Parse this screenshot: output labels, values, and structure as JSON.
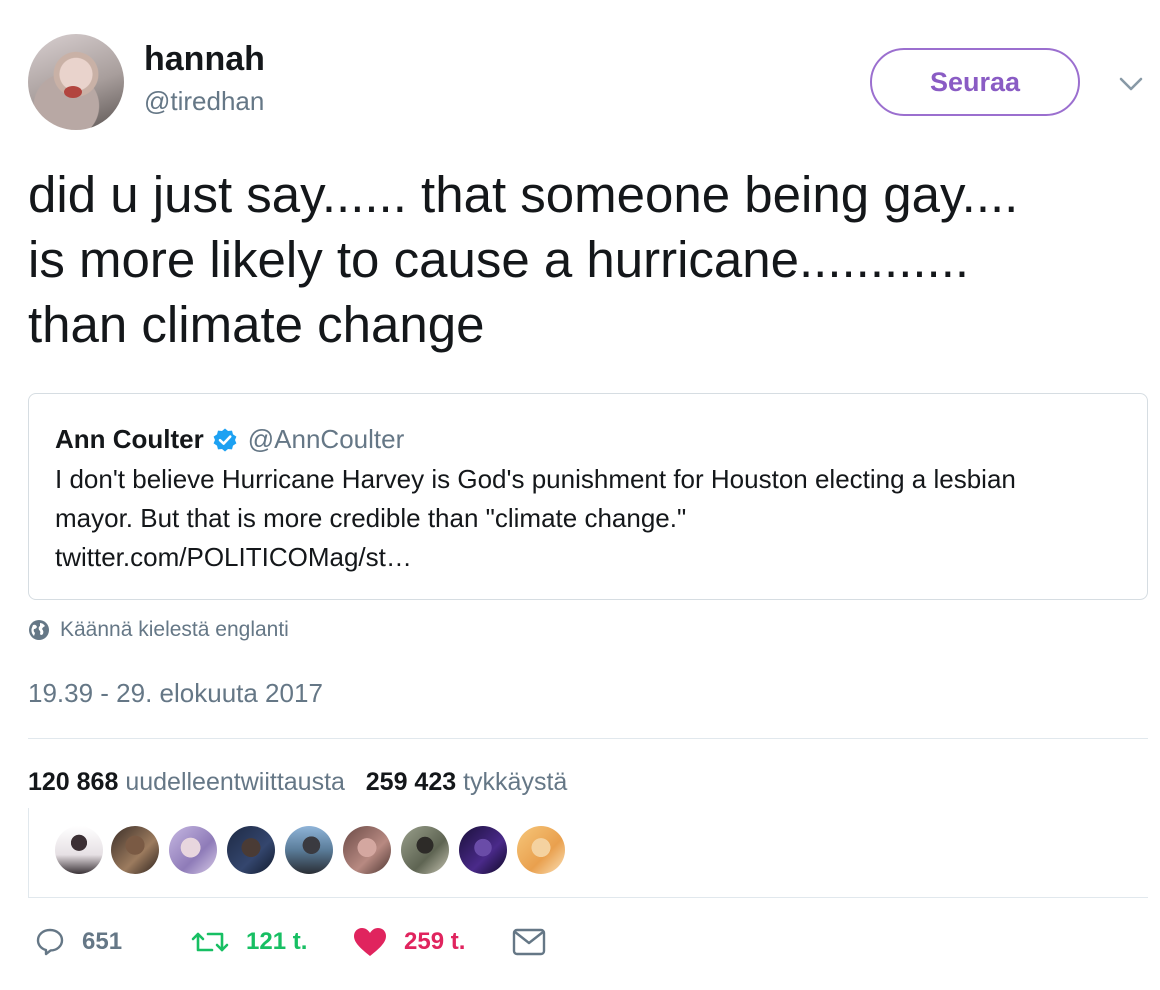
{
  "author": {
    "display_name": "hannah",
    "handle": "@tiredhan",
    "follow_label": "Seuraa"
  },
  "tweet": {
    "lines": [
      "did u just say...... that someone being gay....",
      "is more likely to cause a hurricane............",
      "than climate change"
    ]
  },
  "quoted_tweet": {
    "display_name": "Ann Coulter",
    "handle": "@AnnCoulter",
    "lines": [
      "I don't believe Hurricane Harvey is God's punishment for Houston electing a lesbian",
      "mayor. But that is more credible than \"climate change.\"",
      "twitter.com/POLITICOMag/st…"
    ]
  },
  "translate_label": "Käännä kielestä englanti",
  "timestamp": "19.39 - 29. elokuuta 2017",
  "stats": {
    "retweets_count": "120 868",
    "retweets_label": "uudelleentwiittausta",
    "likes_count": "259 423",
    "likes_label": "tykkäystä"
  },
  "actions": {
    "reply_count": "651",
    "retweet_count": "121 t.",
    "like_count": "259 t."
  },
  "colors": {
    "follow_accent": "#9b6fcf",
    "retweet_green": "#17bf63",
    "like_red": "#e0245e",
    "muted_gray": "#657786",
    "verified_blue": "#1da1f2"
  }
}
